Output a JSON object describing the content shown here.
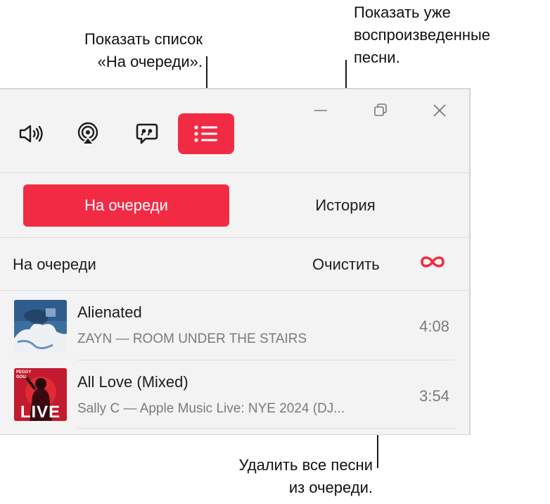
{
  "callouts": {
    "queue_list": "Показать список\n«На очереди».",
    "history": "Показать уже\nвоспроизведенные\nпесни.",
    "clear": "Удалить все песни\nиз очереди."
  },
  "toolbar": {
    "icons": [
      "volume-icon",
      "airplay-icon",
      "lyrics-icon",
      "queue-list-icon"
    ],
    "accent": "#f22b45"
  },
  "tabs": {
    "queue": "На очереди",
    "history": "История"
  },
  "queue": {
    "title": "На очереди",
    "clear_label": "Очистить",
    "infinity_symbol": "∞",
    "tracks": [
      {
        "title": "Alienated",
        "subtitle": "ZAYN — ROOM UNDER THE STAIRS",
        "duration": "4:08"
      },
      {
        "title": "All Love (Mixed)",
        "subtitle": "Sally C — Apple Music Live: NYE 2024 (DJ...",
        "duration": "3:54",
        "art_text": "LIVE",
        "art_small": "PEGGY GOU"
      }
    ]
  }
}
